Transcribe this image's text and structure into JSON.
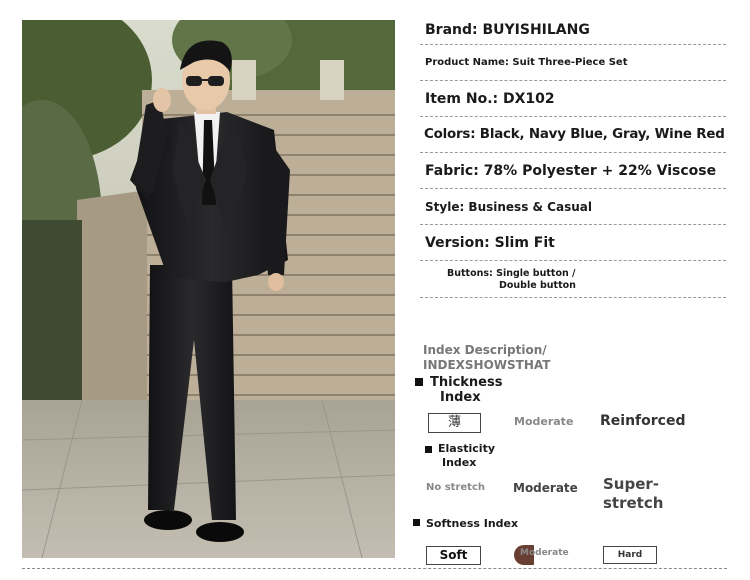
{
  "specs": {
    "brand": "Brand: BUYISHILANG",
    "product_name": "Product Name: Suit Three-Piece Set",
    "item_no": "Item No.: DX102",
    "colors": "Colors: Black, Navy Blue, Gray, Wine Red",
    "fabric": "Fabric: 78% Polyester + 22% Viscose",
    "style": "Style: Business & Casual",
    "version": "Version: Slim Fit",
    "buttons_line1": "Buttons: Single button /",
    "buttons_line2": "Double button"
  },
  "index": {
    "title_line1": "Index Description/",
    "title_line2": "INDEXSHOWSTHAT",
    "thickness": {
      "label_line1": "Thickness",
      "label_line2": "Index",
      "options": [
        "薄",
        "Moderate",
        "Reinforced"
      ],
      "selected": "薄"
    },
    "elasticity": {
      "label_line1": "Elasticity",
      "label_line2": "Index",
      "options": [
        "No stretch",
        "Moderate",
        "Super-",
        "stretch"
      ]
    },
    "softness": {
      "label": "Softness Index",
      "options": [
        "Soft",
        "Moderate",
        "Hard"
      ],
      "selected": "Soft"
    }
  },
  "colors": {
    "text": "#1a1a1a",
    "muted": "#888888",
    "rule": "#9a9a9a",
    "suit": "#1c1c1e",
    "stone": "#b9ab95",
    "foliage": "#4f6138"
  }
}
